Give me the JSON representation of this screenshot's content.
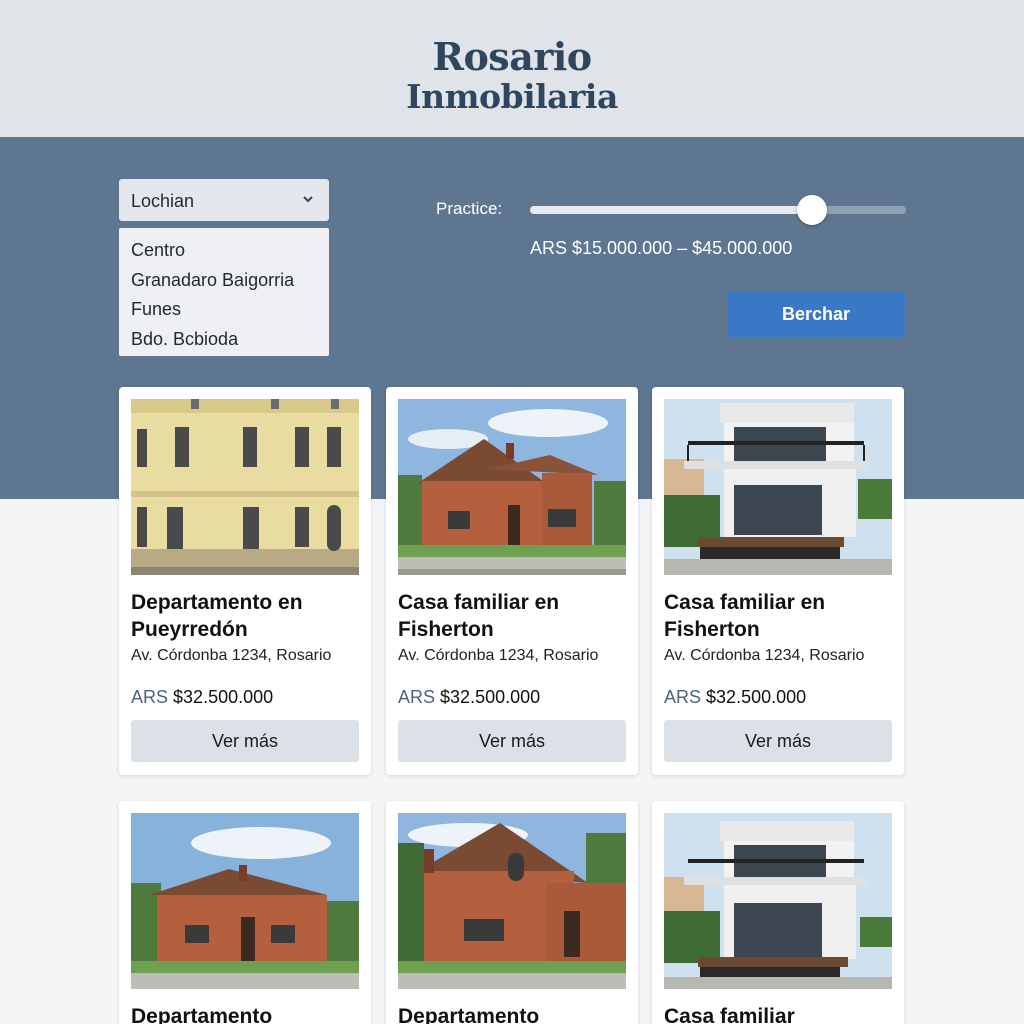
{
  "brand": {
    "line1": "Rosario",
    "line2": "Inmobilaria"
  },
  "filters": {
    "location": {
      "value": "Lochian",
      "options": [
        "Centro",
        "Granadaro Baigorria",
        "Funes",
        "Bdo. Bcbioda"
      ]
    },
    "price": {
      "label": "Practice:",
      "level": 0.75,
      "range_text": "ARS $15.000.000 – $45.000.000"
    },
    "search_label": "Berchar"
  },
  "listings": [
    {
      "title": "Departamento en Pueyrredón",
      "address": "Av. Córdonba 1234, Rosario",
      "currency": "ARS",
      "amount": "$32.500.000",
      "cta": "Ver más",
      "photo": "apartment-photo"
    },
    {
      "title": "Casa familiar en Fisherton",
      "address": "Av. Córdonba 1234, Rosario",
      "currency": "ARS",
      "amount": "$32.500.000",
      "cta": "Ver más",
      "photo": "brick-house-photo"
    },
    {
      "title": "Casa familiar en Fisherton",
      "address": "Av. Córdonba 1234, Rosario",
      "currency": "ARS",
      "amount": "$32.500.000",
      "cta": "Ver más",
      "photo": "modern-house-photo"
    },
    {
      "title": "Departamento",
      "photo": "brick-house-photo"
    },
    {
      "title": "Departamento",
      "photo": "brick-house-photo"
    },
    {
      "title": "Casa familiar",
      "photo": "modern-house-photo"
    }
  ],
  "colors": {
    "accent": "#3a78c5",
    "band": "#5f7690",
    "header": "#e0e3e8",
    "brand": "#2f4660"
  }
}
